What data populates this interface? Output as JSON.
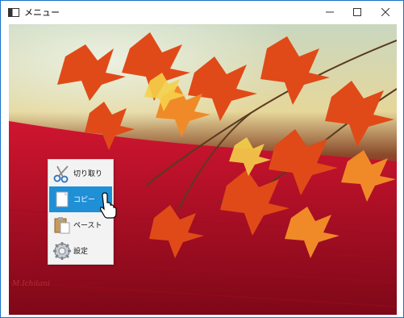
{
  "window": {
    "title": "メニュー",
    "buttons": {
      "minimize": "—",
      "maximize": "☐",
      "close": "✕"
    }
  },
  "context_menu": {
    "items": [
      {
        "label": "切り取り",
        "icon": "scissors-icon",
        "selected": false
      },
      {
        "label": "コピー",
        "icon": "copy-document-icon",
        "selected": true
      },
      {
        "label": "ペースト",
        "icon": "paste-clipboard-icon",
        "selected": false
      },
      {
        "label": "設定",
        "icon": "gear-icon",
        "selected": false
      }
    ]
  },
  "background": {
    "description_icon": "autumn-maple-photo"
  },
  "signature": "M.Ichitani",
  "colors": {
    "accent": "#1f8fd6",
    "window_border": "#1a73c8"
  }
}
